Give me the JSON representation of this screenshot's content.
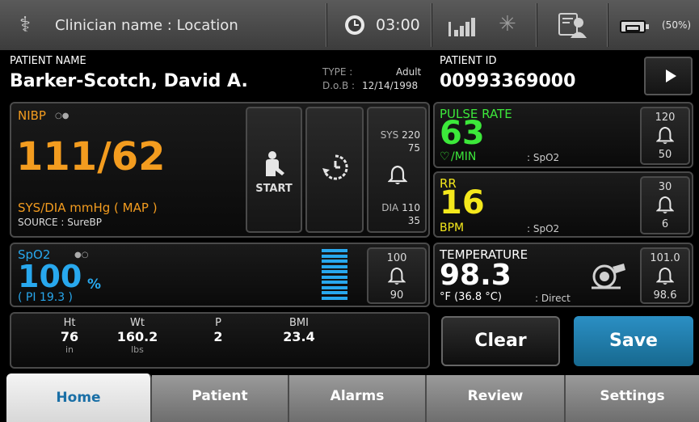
{
  "status_bar": {
    "clinician_location": "Clinician name : Location",
    "clock": "03:00",
    "battery": "(50%)"
  },
  "patient": {
    "name_label": "PATIENT NAME",
    "name": "Barker-Scotch, David A.",
    "type_label": "TYPE :",
    "type_value": "Adult",
    "dob_label": "D.o.B :",
    "dob_value": "12/14/1998",
    "id_label": "PATIENT ID",
    "id": "00993369000"
  },
  "nibp": {
    "title": "NIBP",
    "value": "111/62",
    "units": "SYS/DIA mmHg ( MAP )",
    "source": "SOURCE : SureBP",
    "start_label": "START",
    "sys_label": "SYS",
    "sys_high": "220",
    "sys_low": "75",
    "dia_label": "DIA",
    "dia_high": "110",
    "dia_low": "35"
  },
  "spo2": {
    "title": "SpO2",
    "value": "100",
    "unit": "%",
    "pi": "( PI 19.3 )",
    "alarm_high": "100",
    "alarm_low": "90",
    "signal_bars": 10
  },
  "pulse_rate": {
    "title": "PULSE RATE",
    "value": "63",
    "unit": "/MIN",
    "source": ": SpO2",
    "alarm_high": "120",
    "alarm_low": "50"
  },
  "rr": {
    "title": "RR",
    "value": "16",
    "unit": "BPM",
    "source": ": SpO2",
    "alarm_high": "30",
    "alarm_low": "6"
  },
  "temperature": {
    "title": "TEMPERATURE",
    "value": "98.3",
    "unit": "°F  (36.8 °C)",
    "source": ": Direct",
    "alarm_high": "101.0",
    "alarm_low": "98.6"
  },
  "manual": {
    "fields": [
      {
        "label": "Ht",
        "value": "76",
        "unit": "in"
      },
      {
        "label": "Wt",
        "value": "160.2",
        "unit": "lbs"
      },
      {
        "label": "P",
        "value": "2",
        "unit": ""
      },
      {
        "label": "BMI",
        "value": "23.4",
        "unit": ""
      }
    ]
  },
  "actions": {
    "clear": "Clear",
    "save": "Save"
  },
  "tabs": [
    {
      "label": "Home"
    },
    {
      "label": "Patient"
    },
    {
      "label": "Alarms"
    },
    {
      "label": "Review"
    },
    {
      "label": "Settings"
    }
  ],
  "colors": {
    "nibp": "#f39c1f",
    "spo2": "#28a8ee",
    "pulse": "#3ce83a",
    "rr": "#f4e81c",
    "save": "#1f7fb0"
  }
}
